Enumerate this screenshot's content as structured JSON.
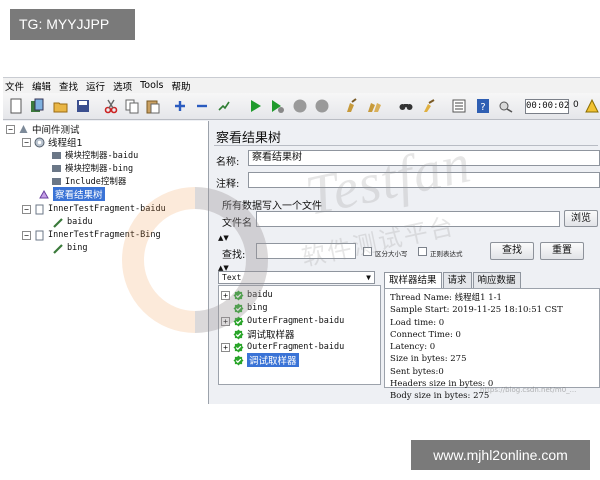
{
  "tag_badge": "TG: MYYJJPP",
  "site_badge": "www.mjhl2online.com",
  "watermark": {
    "brand": "Testfan",
    "subtitle": "软件测试平台",
    "csdn": "https://blog.csdn.net/m0_..."
  },
  "menu": [
    "文件",
    "编辑",
    "查找",
    "运行",
    "选项",
    "Tools",
    "帮助"
  ],
  "toolbar": {
    "icons": [
      "new-icon",
      "templates-icon",
      "open-icon",
      "save-icon",
      "cut-icon",
      "copy-icon",
      "paste-icon",
      "expand-icon",
      "collapse-icon",
      "toggle-icon",
      "start-icon",
      "start-no-pause-icon",
      "stop-icon",
      "shutdown-icon",
      "clear-icon",
      "clear-all-icon",
      "search-icon",
      "reset-search-icon",
      "function-helper-icon",
      "help-icon",
      "remote-icon"
    ],
    "timer": "00:00:02",
    "counter": "0"
  },
  "test_tree": [
    {
      "label": "中间件测试",
      "icon": "test-plan-icon"
    },
    {
      "label": "线程组1",
      "icon": "thread-group-icon"
    },
    {
      "label": "模块控制器-baidu",
      "icon": "module-controller-icon"
    },
    {
      "label": "模块控制器-bing",
      "icon": "module-controller-icon"
    },
    {
      "label": "Include控制器",
      "icon": "include-controller-icon"
    },
    {
      "label": "察看结果树",
      "icon": "results-tree-icon"
    },
    {
      "label": "InnerTestFragment-baidu",
      "icon": "test-fragment-icon"
    },
    {
      "label": "baidu",
      "icon": "sampler-icon"
    },
    {
      "label": "InnerTestFragment-Bing",
      "icon": "test-fragment-icon"
    },
    {
      "label": "bing",
      "icon": "sampler-icon"
    }
  ],
  "panel": {
    "title": "察看结果树",
    "name_label": "名称:",
    "name_value": "察看结果树",
    "comment_label": "注释:",
    "comment_value": "",
    "write_all_label": "所有数据写入一个文件",
    "filename_label": "文件名",
    "filename_value": "",
    "browse_button": "浏览",
    "search_label": "查找:",
    "search_value": "",
    "case_sensitive_label": "区分大小写",
    "regex_label": "正则表达式",
    "search_button": "查找",
    "reset_button": "重置",
    "renderer": "Text"
  },
  "results": [
    {
      "label": "baidu",
      "expandable": true,
      "selected": false
    },
    {
      "label": "bing",
      "expandable": false,
      "selected": false
    },
    {
      "label": "OuterFragment-baidu",
      "expandable": true,
      "selected": false
    },
    {
      "label": "调试取样器",
      "expandable": false,
      "selected": false
    },
    {
      "label": "OuterFragment-baidu",
      "expandable": true,
      "selected": false
    },
    {
      "label": "调试取样器",
      "expandable": false,
      "selected": true
    }
  ],
  "result_tabs": [
    "取样器结果",
    "请求",
    "响应数据"
  ],
  "sampler_result": [
    "Thread Name: 线程组1 1-1",
    "Sample Start: 2019-11-25 18:10:51 CST",
    "Load time: 0",
    "Connect Time: 0",
    "Latency: 0",
    "Size in bytes: 275",
    "Sent bytes:0",
    "Headers size in bytes: 0",
    "Body size in bytes: 275"
  ],
  "colors": {
    "selection": "#3a73d6",
    "play_green": "#1f9a2c",
    "check_green": "#2aa52a"
  }
}
